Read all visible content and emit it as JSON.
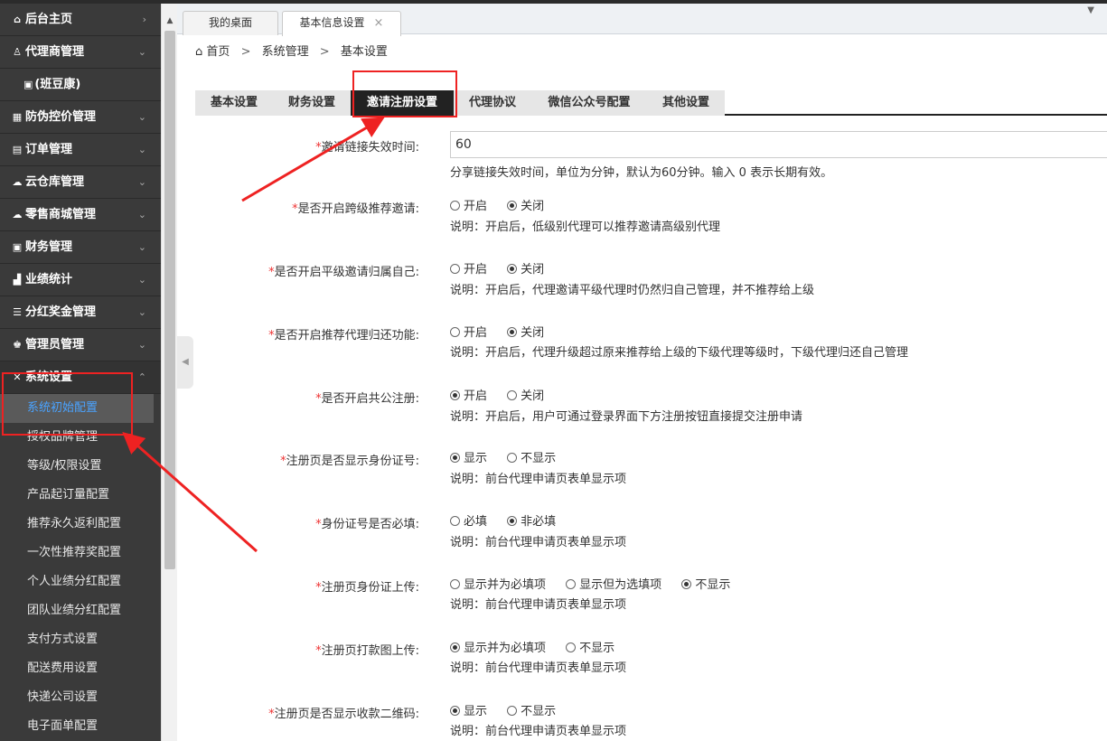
{
  "sidebar": {
    "menu": [
      {
        "name": "home",
        "label": "后台主页",
        "icon": "home-icon",
        "arrow": "›"
      },
      {
        "name": "agent-management",
        "label": "代理商管理",
        "icon": "user-icon",
        "arrow": "⌄"
      },
      {
        "name": "anti-fake",
        "label": "防伪控价管理",
        "icon": "barcode-icon",
        "arrow": "⌄"
      },
      {
        "name": "orders",
        "label": "订单管理",
        "icon": "document-icon",
        "arrow": "⌄"
      },
      {
        "name": "cloud-warehouse",
        "label": "云仓库管理",
        "icon": "cloud-icon",
        "arrow": "⌄"
      },
      {
        "name": "retail-mall",
        "label": "零售商城管理",
        "icon": "cloud-icon",
        "arrow": "⌄"
      },
      {
        "name": "finance",
        "label": "财务管理",
        "icon": "ledger-icon",
        "arrow": "⌄"
      },
      {
        "name": "performance",
        "label": "业绩统计",
        "icon": "bar-chart-icon",
        "arrow": "⌄"
      },
      {
        "name": "dividend",
        "label": "分红奖金管理",
        "icon": "database-icon",
        "arrow": "⌄"
      },
      {
        "name": "admin",
        "label": "管理员管理",
        "icon": "admin-icon",
        "arrow": "⌄"
      },
      {
        "name": "system-settings",
        "label": "系统设置",
        "icon": "tools-icon",
        "arrow": "⌃"
      }
    ],
    "agent_sub": "(班豆康)",
    "system_sub": [
      "系统初始配置",
      "授权品牌管理",
      "等级/权限设置",
      "产品起订量配置",
      "推荐永久返利配置",
      "一次性推荐奖配置",
      "个人业绩分红配置",
      "团队业绩分红配置",
      "支付方式设置",
      "配送费用设置",
      "快递公司设置",
      "电子面单配置"
    ]
  },
  "tabs": {
    "desktop": "我的桌面",
    "basic_info": "基本信息设置",
    "close": "×",
    "menu_icon": "▼"
  },
  "breadcrumb": {
    "home": "首页",
    "sep": ">",
    "level1": "系统管理",
    "level2": "基本设置"
  },
  "settings_tabs": [
    "基本设置",
    "财务设置",
    "邀请注册设置",
    "代理协议",
    "微信公众号配置",
    "其他设置"
  ],
  "form": {
    "required_mark": "*",
    "expire": {
      "label": "邀请链接失效时间:",
      "value": "60",
      "desc": "分享链接失效时间，单位为分钟，默认为60分钟。输入 0 表示长期有效。"
    },
    "cross_level": {
      "label": "是否开启跨级推荐邀请:",
      "options": [
        "开启",
        "关闭"
      ],
      "selected": 1,
      "desc": "说明：开启后，低级别代理可以推荐邀请高级别代理"
    },
    "same_level": {
      "label": "是否开启平级邀请归属自己:",
      "options": [
        "开启",
        "关闭"
      ],
      "selected": 1,
      "desc": "说明：开启后，代理邀请平级代理时仍然归自己管理，并不推荐给上级"
    },
    "return_agent": {
      "label": "是否开启推荐代理归还功能:",
      "options": [
        "开启",
        "关闭"
      ],
      "selected": 1,
      "desc": "说明：开启后，代理升级超过原来推荐给上级的下级代理等级时，下级代理归还自己管理"
    },
    "public_reg": {
      "label": "是否开启共公注册:",
      "options": [
        "开启",
        "关闭"
      ],
      "selected": 0,
      "desc": "说明：开启后，用户可通过登录界面下方注册按钮直接提交注册申请"
    },
    "show_id": {
      "label": "注册页是否显示身份证号:",
      "options": [
        "显示",
        "不显示"
      ],
      "selected": 0,
      "desc": "说明：前台代理申请页表单显示项"
    },
    "id_required": {
      "label": "身份证号是否必填:",
      "options": [
        "必填",
        "非必填"
      ],
      "selected": 1,
      "desc": "说明：前台代理申请页表单显示项"
    },
    "id_upload": {
      "label": "注册页身份证上传:",
      "options": [
        "显示并为必填项",
        "显示但为选填项",
        "不显示"
      ],
      "selected": 2,
      "desc": "说明：前台代理申请页表单显示项"
    },
    "payment_proof": {
      "label": "注册页打款图上传:",
      "options": [
        "显示并为必填项",
        "不显示"
      ],
      "selected": 0,
      "desc": "说明：前台代理申请页表单显示项"
    },
    "qr_code": {
      "label": "注册页是否显示收款二维码:",
      "options": [
        "显示",
        "不显示"
      ],
      "selected": 0,
      "desc": "说明：前台代理申请页表单显示项"
    }
  },
  "colors": {
    "sidebar_bg": "#3a3a3a",
    "active_tab": "#222222",
    "annotation": "#ee2222",
    "required": "#ee3333",
    "active_link": "#4aa3ff"
  }
}
